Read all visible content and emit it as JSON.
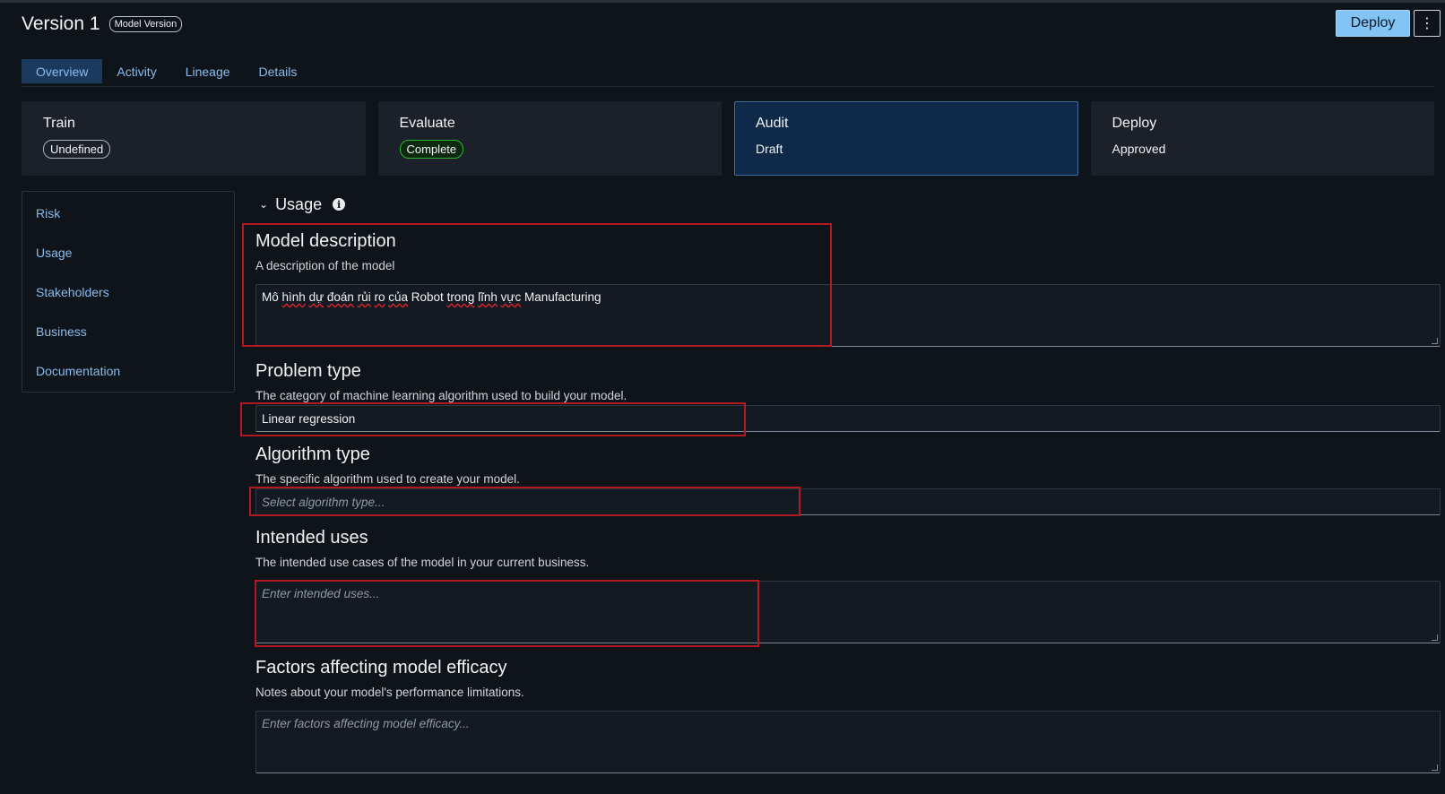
{
  "header": {
    "title": "Version 1",
    "badge": "Model Version",
    "deploy_label": "Deploy",
    "more_label": "⋮"
  },
  "tabs": [
    {
      "label": "Overview",
      "active": true
    },
    {
      "label": "Activity",
      "active": false
    },
    {
      "label": "Lineage",
      "active": false
    },
    {
      "label": "Details",
      "active": false
    }
  ],
  "stages": [
    {
      "name": "Train",
      "status": "Undefined",
      "kind": "badge-undefined"
    },
    {
      "name": "Evaluate",
      "status": "Complete",
      "kind": "badge-complete"
    },
    {
      "name": "Audit",
      "status": "Draft",
      "kind": "text",
      "selected": true
    },
    {
      "name": "Deploy",
      "status": "Approved",
      "kind": "text"
    }
  ],
  "sidenav": {
    "items": [
      "Risk",
      "Usage",
      "Stakeholders",
      "Business",
      "Documentation"
    ]
  },
  "section": {
    "title": "Usage",
    "info_icon": "i"
  },
  "fields": {
    "model_description": {
      "label": "Model description",
      "desc": "A description of the model",
      "value_parts": [
        "Mô ",
        "hình",
        " ",
        "dự",
        " ",
        "đoán",
        " ",
        "rủi",
        " ",
        "ro",
        " ",
        "của",
        " Robot ",
        "trong",
        " ",
        "lĩnh",
        " ",
        "vực",
        " Manufacturing"
      ]
    },
    "problem_type": {
      "label": "Problem type",
      "desc": "The category of machine learning algorithm used to build your model.",
      "value": "Linear regression"
    },
    "algorithm_type": {
      "label": "Algorithm type",
      "desc": "The specific algorithm used to create your model.",
      "placeholder": "Select algorithm type..."
    },
    "intended_uses": {
      "label": "Intended uses",
      "desc": "The intended use cases of the model in your current business.",
      "placeholder": "Enter intended uses..."
    },
    "factors": {
      "label": "Factors affecting model efficacy",
      "desc": "Notes about your model's performance limitations.",
      "placeholder": "Enter factors affecting model efficacy..."
    }
  },
  "colors": {
    "accent": "#89bdee",
    "deploy_button": "#82c4f3",
    "highlight": "#b11a22",
    "complete": "#2bb534"
  }
}
